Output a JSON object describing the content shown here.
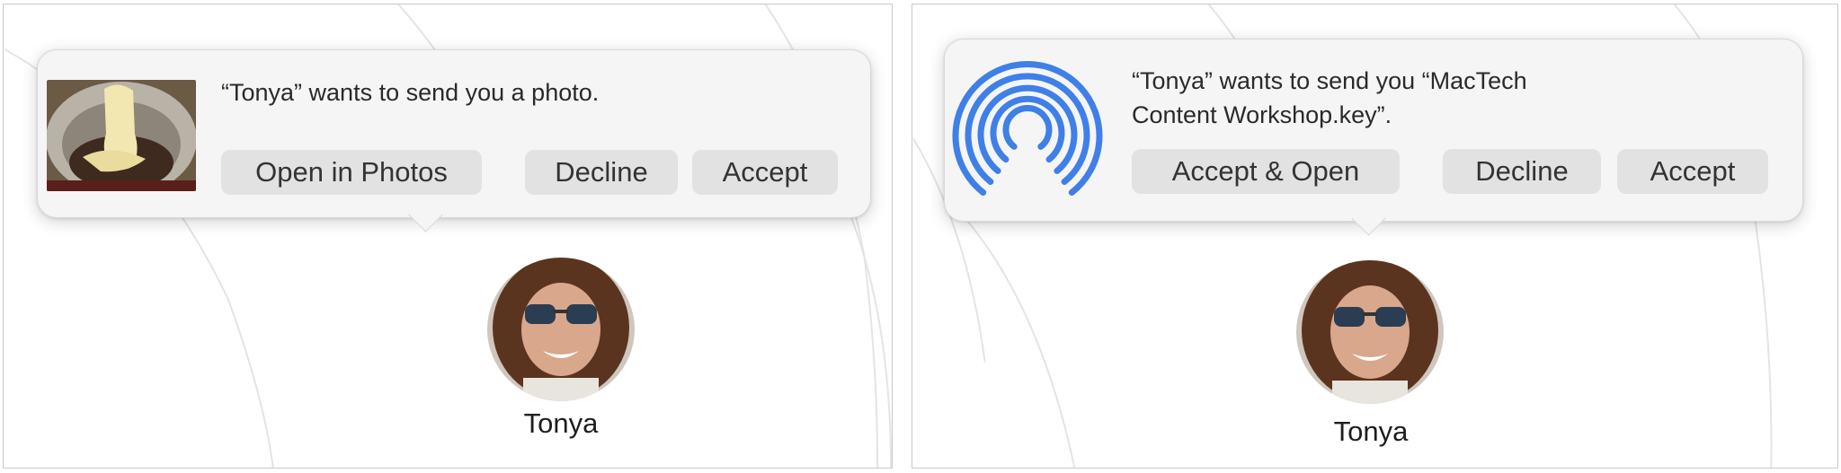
{
  "left": {
    "message": "“Tonya” wants to send you a photo.",
    "buttons": {
      "open_in_photos": "Open in Photos",
      "decline": "Decline",
      "accept": "Accept"
    },
    "contact_name": "Tonya",
    "thumbnail_icon": "photo-thumbnail"
  },
  "right": {
    "message_line1": "“Tonya” wants to send you “MacTech",
    "message_line2": "Content Workshop.key”.",
    "buttons": {
      "accept_open": "Accept & Open",
      "decline": "Decline",
      "accept": "Accept"
    },
    "contact_name": "Tonya",
    "icon": "airdrop-icon"
  },
  "colors": {
    "popover_bg": "#f5f5f5",
    "button_bg": "#e2e2e2",
    "airdrop_blue": "#3f7fe8"
  }
}
